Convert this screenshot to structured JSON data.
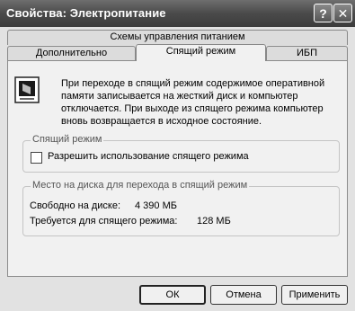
{
  "window": {
    "title": "Свойства: Электропитание",
    "help_button": "?",
    "close_button": "✕"
  },
  "tabs": {
    "top_row": [
      "Схемы управления питанием"
    ],
    "bottom_row": [
      "Дополнительно",
      "Спящий режим",
      "ИБП"
    ],
    "active": "Спящий режим"
  },
  "description": "При переходе в спящий режим содержимое оперативной памяти записывается на жесткий диск и компьютер отключается. При выходе из спящего режима компьютер вновь возвращается в исходное состояние.",
  "hibernate_group": {
    "title": "Спящий режим",
    "checkbox_label": "Разрешить использование спящего режима",
    "checked": false
  },
  "disk_group": {
    "title": "Место на диска для перехода в спящий режим",
    "free_label": "Свободно на диске:",
    "free_value": "4 390 МБ",
    "required_label": "Требуется для спящего режима:",
    "required_value": "128 МБ"
  },
  "buttons": {
    "ok": "ОК",
    "cancel": "Отмена",
    "apply": "Применить"
  }
}
